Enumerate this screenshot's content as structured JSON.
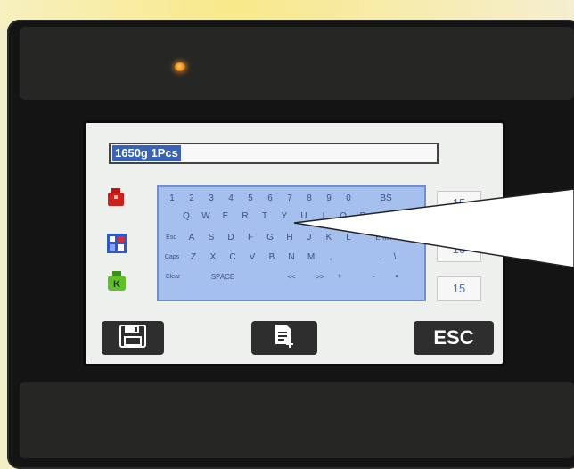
{
  "display": {
    "entry_text": "1650g 1Pcs"
  },
  "keyboard": {
    "rows": [
      [
        "1",
        "2",
        "3",
        "4",
        "5",
        "6",
        "7",
        "8",
        "9",
        "0",
        "BS"
      ],
      [
        "Q",
        "W",
        "E",
        "R",
        "T",
        "Y",
        "U",
        "I",
        "O",
        "P"
      ],
      [
        "Esc",
        "A",
        "S",
        "D",
        "F",
        "G",
        "H",
        "J",
        "K",
        "L",
        "Enter"
      ],
      [
        "Caps",
        "Z",
        "X",
        "C",
        "V",
        "B",
        "N",
        "M",
        ",",
        ".",
        "\\"
      ],
      [
        "Clear",
        "SPACE",
        "<<",
        ">>",
        "+",
        "-",
        "•"
      ]
    ]
  },
  "side_values": [
    "15",
    "10",
    "15"
  ],
  "buttons": {
    "esc_label": "ESC",
    "save_icon": "save-icon",
    "doc_icon": "add-document-icon"
  },
  "indicator_colors": {
    "weight": "#d0201a",
    "count": "#2f58c8",
    "k": "#4caa20",
    "led": "#f0921e"
  }
}
